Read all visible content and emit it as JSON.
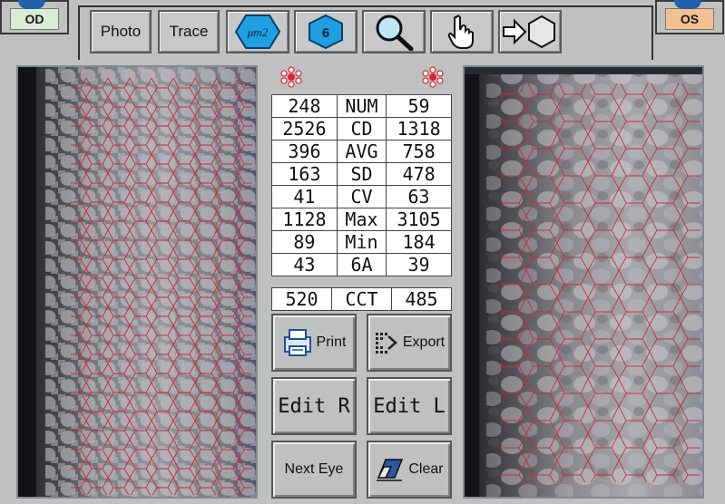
{
  "eye_tabs": {
    "od_label": "OD",
    "os_label": "OS"
  },
  "toolbar": {
    "photo_label": "Photo",
    "trace_label": "Trace",
    "um2_label": "μm2",
    "six_label": "6"
  },
  "table_rows": [
    {
      "right": "248",
      "label": "NUM",
      "left": "59"
    },
    {
      "right": "2526",
      "label": "CD",
      "left": "1318"
    },
    {
      "right": "396",
      "label": "AVG",
      "left": "758"
    },
    {
      "right": "163",
      "label": "SD",
      "left": "478"
    },
    {
      "right": "41",
      "label": "CV",
      "left": "63"
    },
    {
      "right": "1128",
      "label": "Max",
      "left": "3105"
    },
    {
      "right": "89",
      "label": "Min",
      "left": "184"
    },
    {
      "right": "43",
      "label": "6A",
      "left": "39"
    }
  ],
  "cct_row": {
    "right": "520",
    "label": "CCT",
    "left": "485"
  },
  "buttons": {
    "print": "Print",
    "export": "Export",
    "edit_r": "Edit R",
    "edit_l": "Edit L",
    "next_eye": "Next Eye",
    "clear": "Clear"
  },
  "colors": {
    "od_tab": "#d7ecd3",
    "os_tab": "#f5c090",
    "hex_blue": "#1e9fe0",
    "trace_red": "#c8283a"
  }
}
